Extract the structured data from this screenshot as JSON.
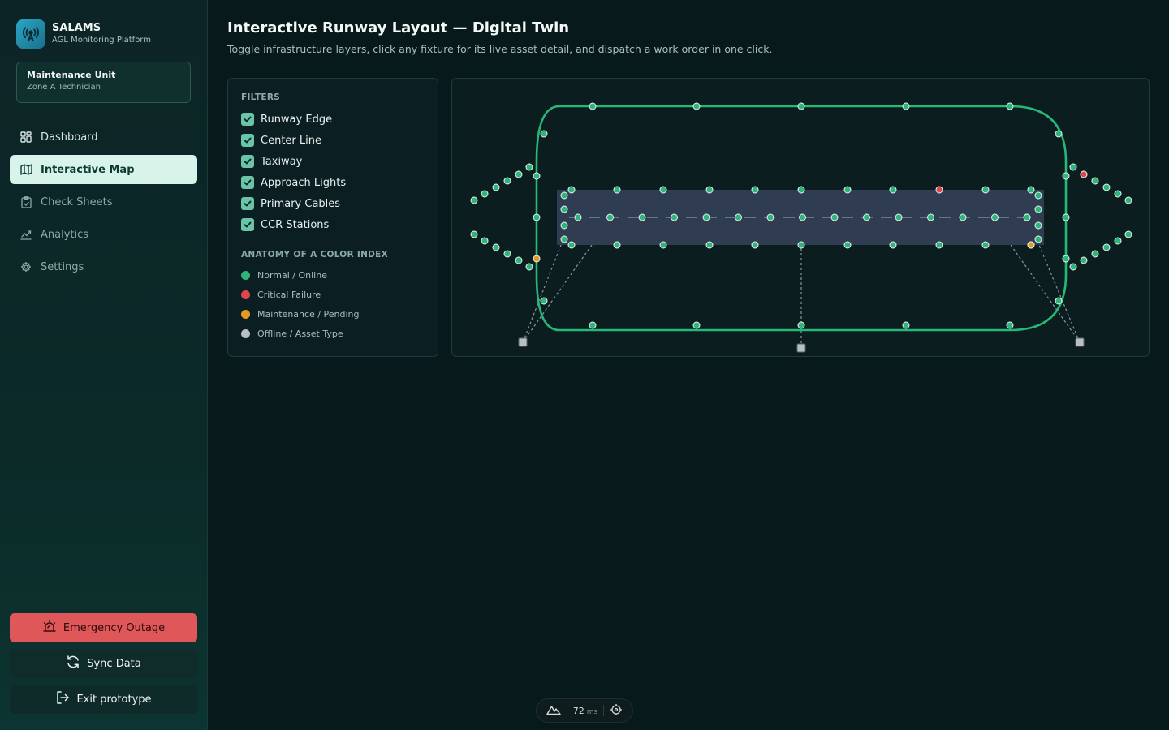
{
  "brand": {
    "name": "SALAMS",
    "subtitle": "AGL Monitoring Platform"
  },
  "unit": {
    "title": "Maintenance Unit",
    "subtitle": "Zone A Technician"
  },
  "nav": [
    {
      "label": "Dashboard",
      "icon": "grid-icon"
    },
    {
      "label": "Interactive Map",
      "icon": "map-icon",
      "active": true
    },
    {
      "label": "Check Sheets",
      "icon": "clipboard-icon"
    },
    {
      "label": "Analytics",
      "icon": "chart-icon"
    },
    {
      "label": "Settings",
      "icon": "gear-icon"
    }
  ],
  "actions": {
    "emergency": "Emergency Outage",
    "sync": "Sync Data",
    "exit": "Exit prototype"
  },
  "header": {
    "title": "Interactive Runway Layout — Digital Twin",
    "subtitle": "Toggle infrastructure layers, click any fixture for its live asset detail, and dispatch a work order in one click."
  },
  "filters": {
    "heading": "FILTERS",
    "items": [
      {
        "label": "Runway Edge",
        "checked": true
      },
      {
        "label": "Center Line",
        "checked": true
      },
      {
        "label": "Taxiway",
        "checked": true
      },
      {
        "label": "Approach Lights",
        "checked": true
      },
      {
        "label": "Primary Cables",
        "checked": true
      },
      {
        "label": "CCR Stations",
        "checked": true
      }
    ]
  },
  "legend": {
    "heading": "ANATOMY OF A COLOR INDEX",
    "items": [
      {
        "label": "Normal / Online",
        "color": "#2fb57c"
      },
      {
        "label": "Critical Failure",
        "color": "#e0454f"
      },
      {
        "label": "Maintenance / Pending",
        "color": "#e69a24"
      },
      {
        "label": "Offline / Asset Type",
        "color": "#b9c0c5"
      }
    ]
  },
  "perf": {
    "value": "72",
    "unit": "ms"
  },
  "colors": {
    "normal": "#2fb57c",
    "critical": "#e0454f",
    "maintenance": "#e69a24",
    "offline": "#b9c0c5",
    "accent": "#d8f3ea"
  }
}
